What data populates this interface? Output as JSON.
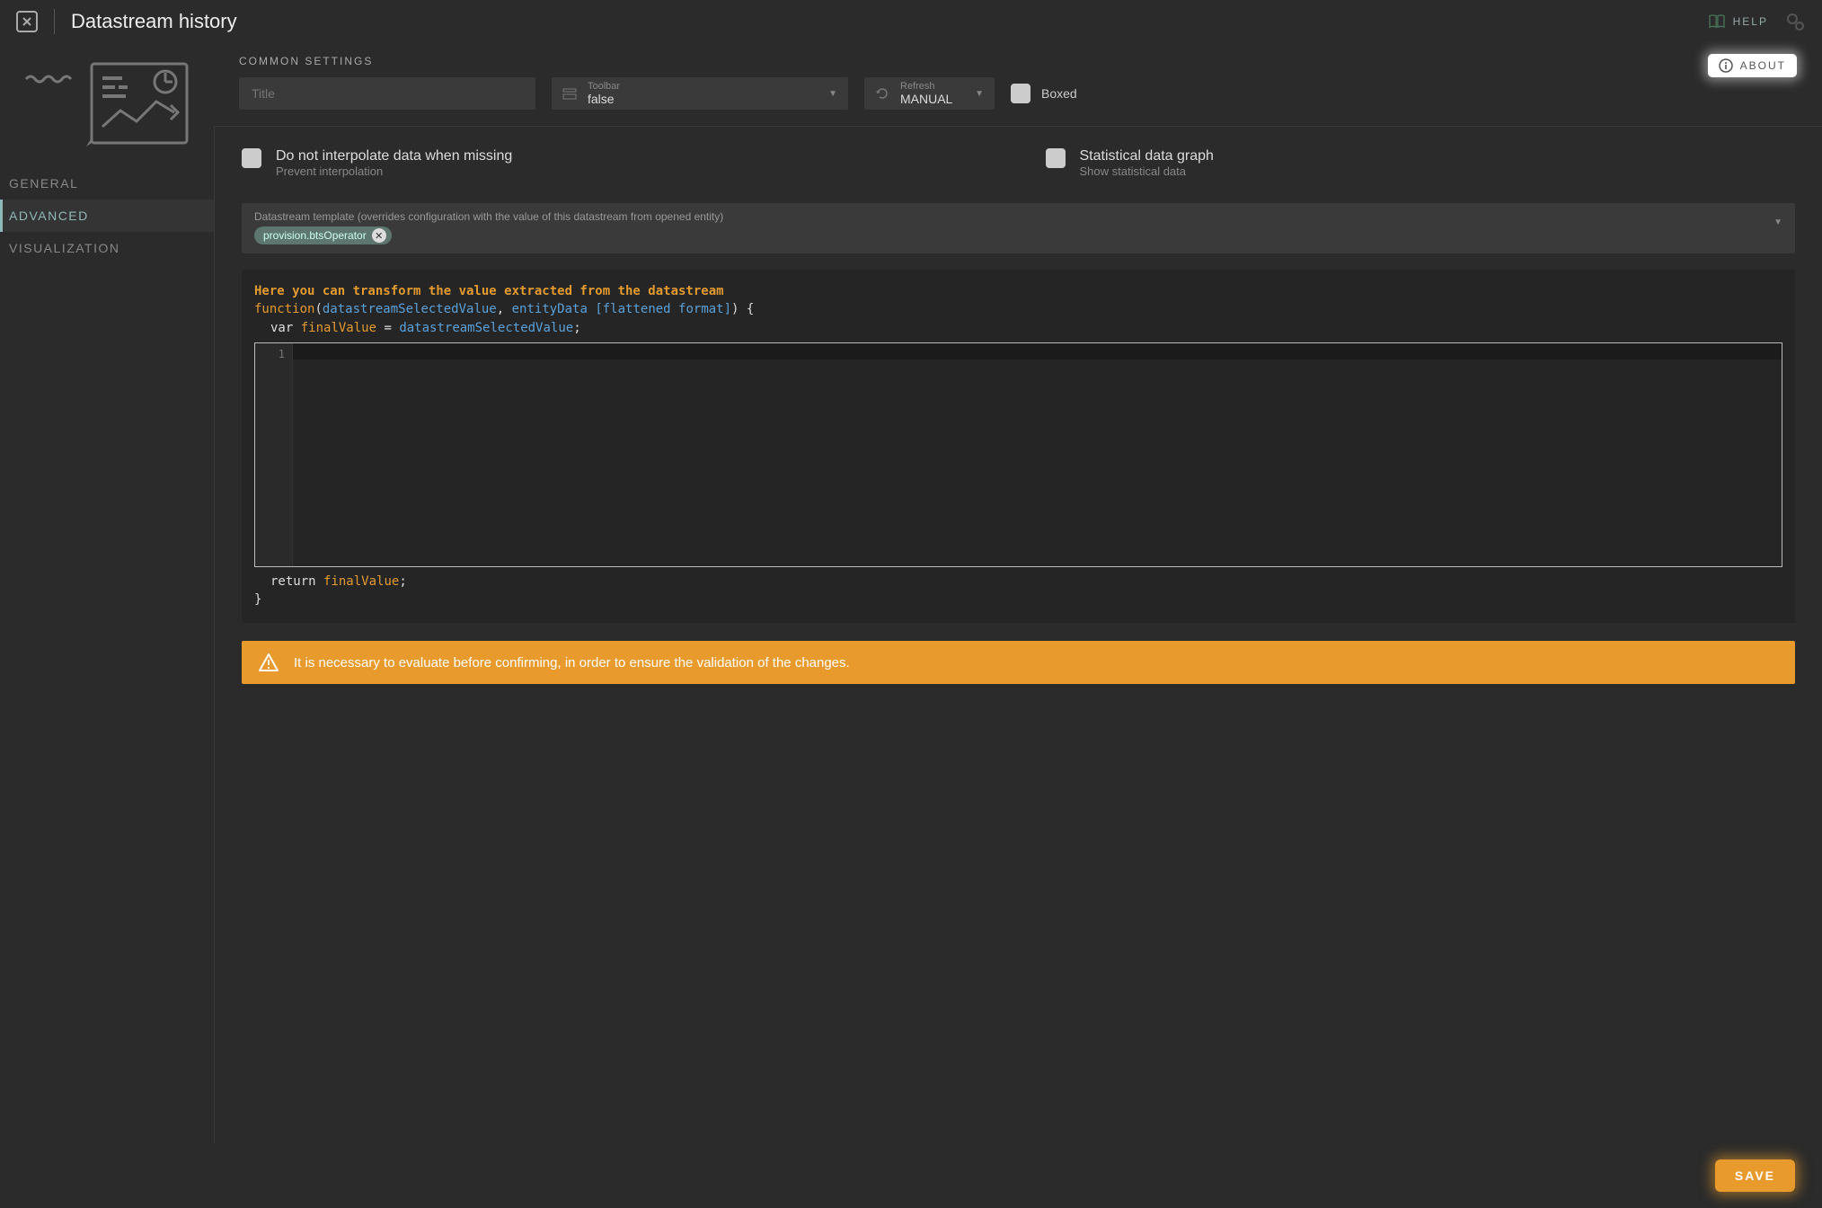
{
  "header": {
    "title": "Datastream history",
    "help_label": "HELP"
  },
  "sidebar": {
    "items": [
      {
        "label": "GENERAL"
      },
      {
        "label": "ADVANCED"
      },
      {
        "label": "VISUALIZATION"
      }
    ],
    "active_index": 1
  },
  "common": {
    "section_label": "COMMON SETTINGS",
    "about_label": "ABOUT",
    "title_placeholder": "Title",
    "title_value": "",
    "toolbar": {
      "label": "Toolbar",
      "value": "false"
    },
    "refresh": {
      "label": "Refresh",
      "value": "MANUAL"
    },
    "boxed": {
      "label": "Boxed",
      "checked": false
    }
  },
  "advanced": {
    "interpolate": {
      "title": "Do not interpolate data when missing",
      "subtitle": "Prevent interpolation",
      "checked": false
    },
    "statgraph": {
      "title": "Statistical data graph",
      "subtitle": "Show statistical data",
      "checked": false
    },
    "template": {
      "label": "Datastream template (overrides configuration with the value of this datastream from opened entity)",
      "chip": "provision.btsOperator"
    },
    "code": {
      "heading": "Here you can transform the value extracted from the datastream",
      "fn_kw": "function",
      "param1": "datastreamSelectedValue",
      "param2": "entityData [flattened format]",
      "line2_var": "var",
      "line2_name": "finalValue",
      "line2_eq": " = ",
      "line2_rhs": "datastreamSelectedValue",
      "gutter_line": "1",
      "return_kw": "return",
      "return_name": "finalValue"
    },
    "warning": "It is necessary to evaluate before confirming, in order to ensure the validation of the changes."
  },
  "footer": {
    "save_label": "SAVE"
  }
}
